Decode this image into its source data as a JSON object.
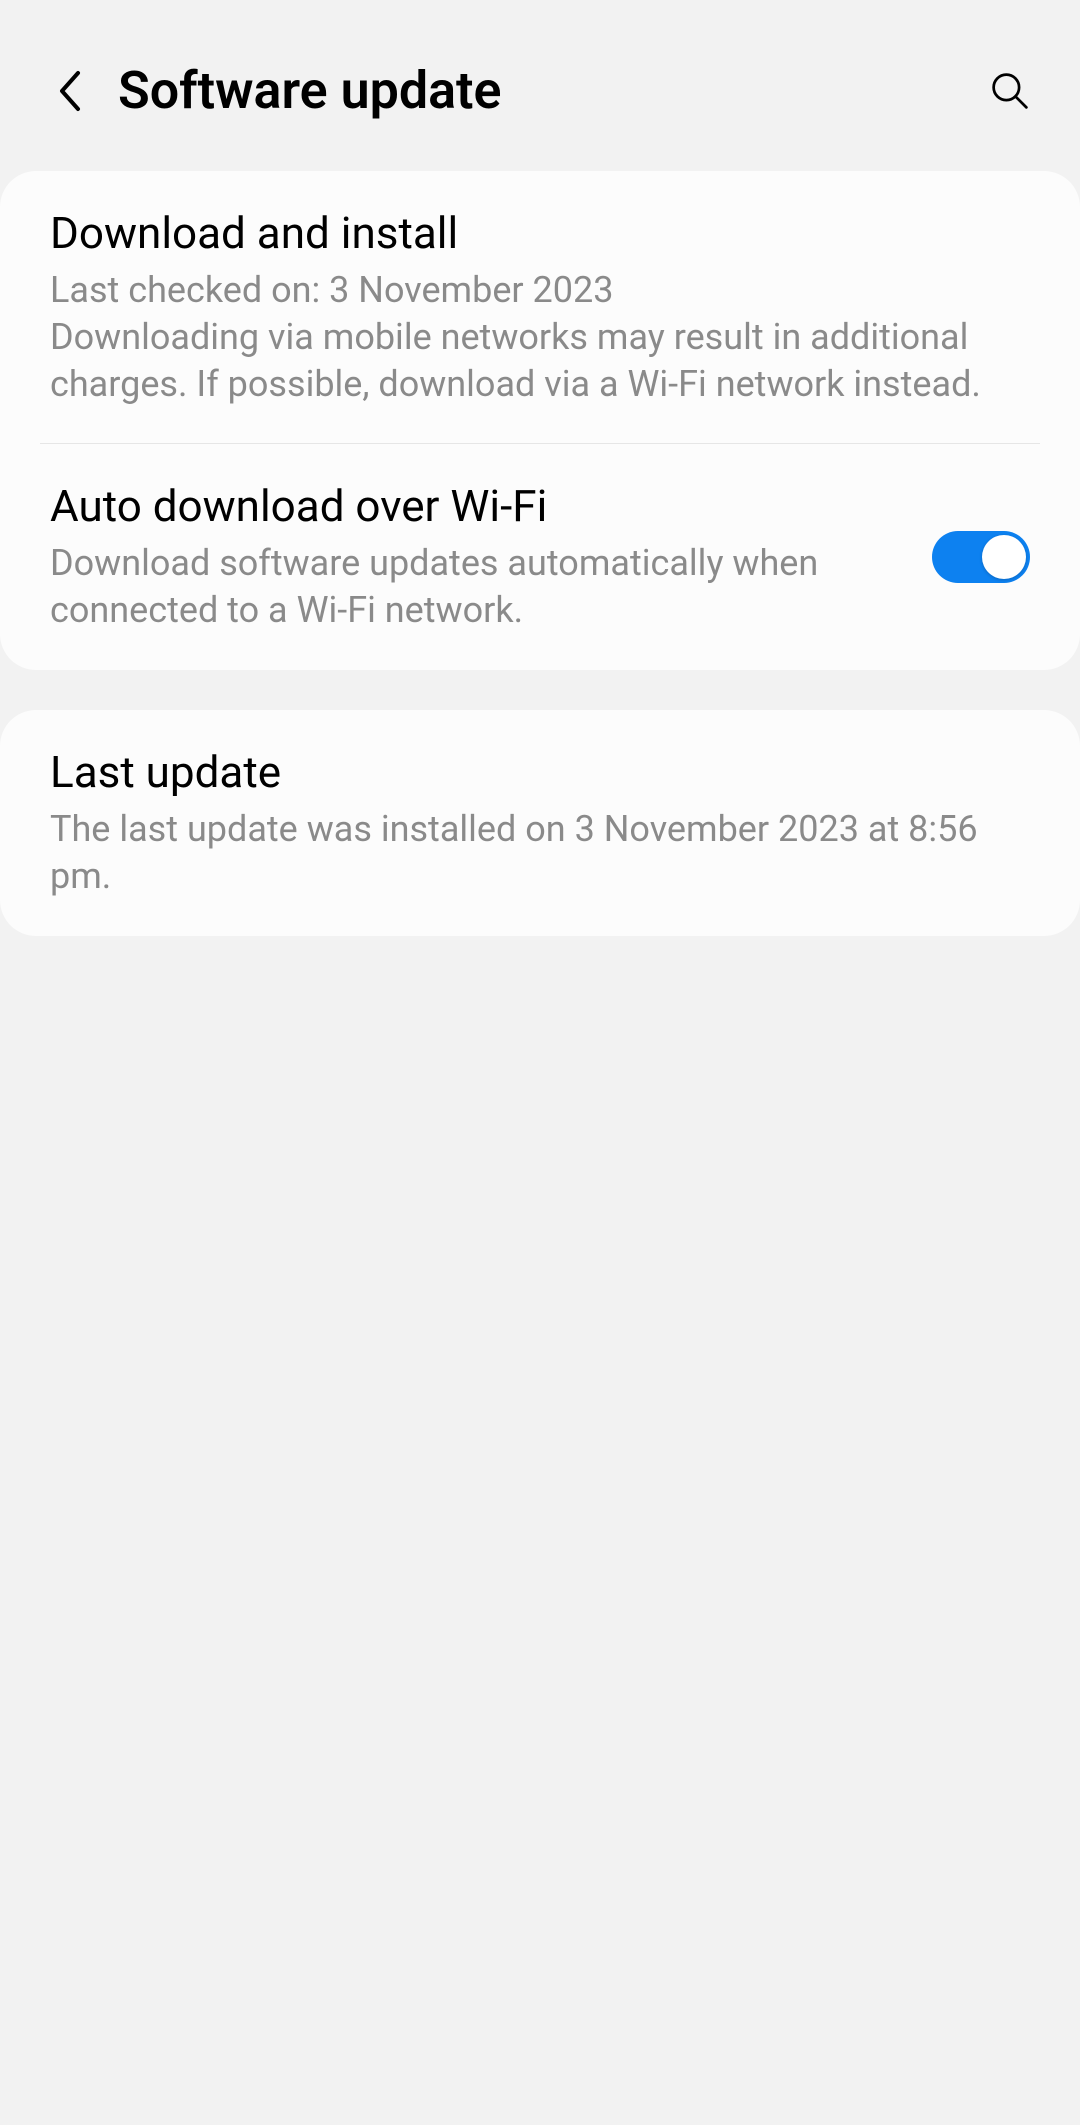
{
  "header": {
    "title": "Software update"
  },
  "items": {
    "download_install": {
      "title": "Download and install",
      "description": "Last checked on: 3 November 2023\nDownloading via mobile networks may result in additional charges. If possible, download via a Wi-Fi network instead."
    },
    "auto_download": {
      "title": "Auto download over Wi-Fi",
      "description": "Download software updates automatically when connected to a Wi-Fi network.",
      "toggle_on": true
    },
    "last_update": {
      "title": "Last update",
      "description": "The last update was installed on 3 November 2023 at 8:56 pm."
    }
  }
}
